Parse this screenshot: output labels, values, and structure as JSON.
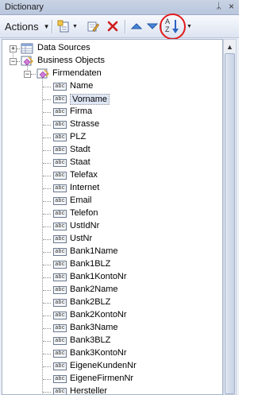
{
  "window": {
    "title": "Dictionary",
    "pin_glyph": "ᛦ",
    "close_glyph": "×"
  },
  "toolbar": {
    "actions_label": "Actions",
    "icons": {
      "new_item": "new-item-icon",
      "edit": "edit-icon",
      "delete": "delete-icon",
      "move_up": "move-up-icon",
      "move_down": "move-down-icon",
      "sort": "sort-az-icon"
    },
    "sort_glyph_top": "A",
    "sort_glyph_bottom": "Z",
    "highlight_color": "#e21b1b"
  },
  "tree": {
    "data_sources": "Data Sources",
    "business_objects": "Business Objects",
    "firmendaten": "Firmendaten",
    "field_icon_text": "abc",
    "fields": [
      "Name",
      "Vorname",
      "Firma",
      "Strasse",
      "PLZ",
      "Stadt",
      "Staat",
      "Telefax",
      "Internet",
      "Email",
      "Telefon",
      "UstIdNr",
      "UstNr",
      "Bank1Name",
      "Bank1BLZ",
      "Bank1KontoNr",
      "Bank2Name",
      "Bank2BLZ",
      "Bank2KontoNr",
      "Bank3Name",
      "Bank3BLZ",
      "Bank3KontoNr",
      "EigeneKundenNr",
      "EigeneFirmenNr",
      "Hersteller"
    ],
    "selected_field": "Vorname"
  }
}
